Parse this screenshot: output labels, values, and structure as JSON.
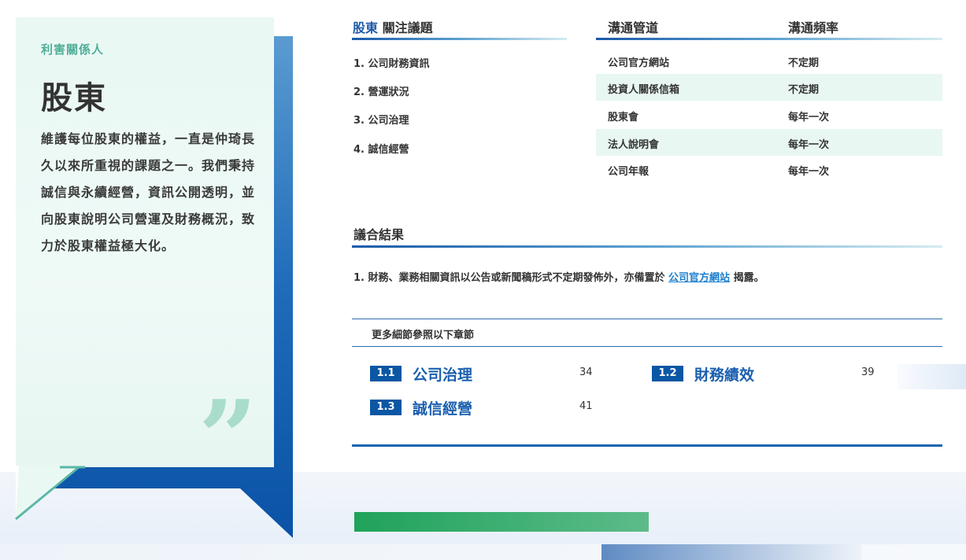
{
  "sidebar_card": {
    "kicker": "利害關係人",
    "title": "股東",
    "body": "維護每位股東的權益，一直是仲琦長久以來所重視的課題之一。我們秉持誠信與永續經營，資訊公開透明，並向股東說明公司營運及財務概況，致力於股東權益極大化。"
  },
  "issues": {
    "header_accent": "股東",
    "header_rest": " 關注議題",
    "items": [
      "1. 公司財務資訊",
      "2. 營運狀況",
      "3. 公司治理",
      "4. 誠信經營"
    ]
  },
  "channels": {
    "col_channel": "溝通管道",
    "col_frequency": "溝通頻率",
    "rows": [
      {
        "channel": "公司官方網站",
        "frequency": "不定期"
      },
      {
        "channel": "投資人關係信箱",
        "frequency": "不定期"
      },
      {
        "channel": "股東會",
        "frequency": "每年一次"
      },
      {
        "channel": "法人說明會",
        "frequency": "每年一次"
      },
      {
        "channel": "公司年報",
        "frequency": "每年一次"
      }
    ]
  },
  "results": {
    "header": "議合結果",
    "item_prefix": "1. 財務、業務相關資訊以公告或新聞稿形式不定期發佈外，亦備置於 ",
    "item_link": "公司官方網站",
    "item_suffix": " 揭露。"
  },
  "more_details": {
    "label": "更多細節參照以下章節",
    "chapters": [
      {
        "num": "1.1",
        "title": "公司治理",
        "page": "34"
      },
      {
        "num": "1.2",
        "title": "財務績效",
        "page": "39"
      },
      {
        "num": "1.3",
        "title": "誠信經營",
        "page": "41"
      }
    ]
  },
  "colors": {
    "brand_blue": "#0b57a4",
    "accent_green": "#4fae97",
    "card_bg": "#e9f8f3",
    "link": "#1d7fcf"
  }
}
